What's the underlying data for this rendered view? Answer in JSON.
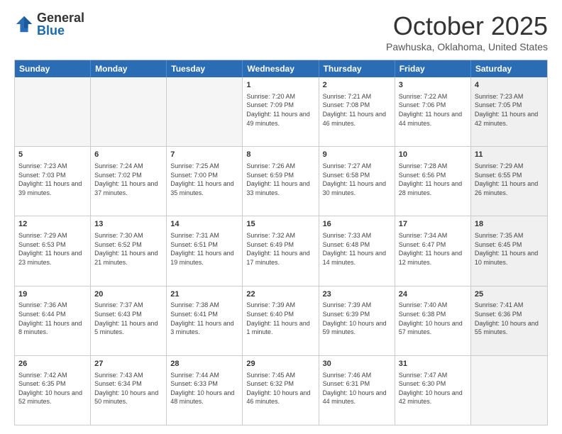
{
  "logo": {
    "general": "General",
    "blue": "Blue"
  },
  "title": "October 2025",
  "location": "Pawhuska, Oklahoma, United States",
  "days": [
    "Sunday",
    "Monday",
    "Tuesday",
    "Wednesday",
    "Thursday",
    "Friday",
    "Saturday"
  ],
  "weeks": [
    [
      {
        "day": "",
        "info": "",
        "empty": true
      },
      {
        "day": "",
        "info": "",
        "empty": true
      },
      {
        "day": "",
        "info": "",
        "empty": true
      },
      {
        "day": "1",
        "info": "Sunrise: 7:20 AM\nSunset: 7:09 PM\nDaylight: 11 hours and 49 minutes."
      },
      {
        "day": "2",
        "info": "Sunrise: 7:21 AM\nSunset: 7:08 PM\nDaylight: 11 hours and 46 minutes."
      },
      {
        "day": "3",
        "info": "Sunrise: 7:22 AM\nSunset: 7:06 PM\nDaylight: 11 hours and 44 minutes."
      },
      {
        "day": "4",
        "info": "Sunrise: 7:23 AM\nSunset: 7:05 PM\nDaylight: 11 hours and 42 minutes."
      }
    ],
    [
      {
        "day": "5",
        "info": "Sunrise: 7:23 AM\nSunset: 7:03 PM\nDaylight: 11 hours and 39 minutes."
      },
      {
        "day": "6",
        "info": "Sunrise: 7:24 AM\nSunset: 7:02 PM\nDaylight: 11 hours and 37 minutes."
      },
      {
        "day": "7",
        "info": "Sunrise: 7:25 AM\nSunset: 7:00 PM\nDaylight: 11 hours and 35 minutes."
      },
      {
        "day": "8",
        "info": "Sunrise: 7:26 AM\nSunset: 6:59 PM\nDaylight: 11 hours and 33 minutes."
      },
      {
        "day": "9",
        "info": "Sunrise: 7:27 AM\nSunset: 6:58 PM\nDaylight: 11 hours and 30 minutes."
      },
      {
        "day": "10",
        "info": "Sunrise: 7:28 AM\nSunset: 6:56 PM\nDaylight: 11 hours and 28 minutes."
      },
      {
        "day": "11",
        "info": "Sunrise: 7:29 AM\nSunset: 6:55 PM\nDaylight: 11 hours and 26 minutes."
      }
    ],
    [
      {
        "day": "12",
        "info": "Sunrise: 7:29 AM\nSunset: 6:53 PM\nDaylight: 11 hours and 23 minutes."
      },
      {
        "day": "13",
        "info": "Sunrise: 7:30 AM\nSunset: 6:52 PM\nDaylight: 11 hours and 21 minutes."
      },
      {
        "day": "14",
        "info": "Sunrise: 7:31 AM\nSunset: 6:51 PM\nDaylight: 11 hours and 19 minutes."
      },
      {
        "day": "15",
        "info": "Sunrise: 7:32 AM\nSunset: 6:49 PM\nDaylight: 11 hours and 17 minutes."
      },
      {
        "day": "16",
        "info": "Sunrise: 7:33 AM\nSunset: 6:48 PM\nDaylight: 11 hours and 14 minutes."
      },
      {
        "day": "17",
        "info": "Sunrise: 7:34 AM\nSunset: 6:47 PM\nDaylight: 11 hours and 12 minutes."
      },
      {
        "day": "18",
        "info": "Sunrise: 7:35 AM\nSunset: 6:45 PM\nDaylight: 11 hours and 10 minutes."
      }
    ],
    [
      {
        "day": "19",
        "info": "Sunrise: 7:36 AM\nSunset: 6:44 PM\nDaylight: 11 hours and 8 minutes."
      },
      {
        "day": "20",
        "info": "Sunrise: 7:37 AM\nSunset: 6:43 PM\nDaylight: 11 hours and 5 minutes."
      },
      {
        "day": "21",
        "info": "Sunrise: 7:38 AM\nSunset: 6:41 PM\nDaylight: 11 hours and 3 minutes."
      },
      {
        "day": "22",
        "info": "Sunrise: 7:39 AM\nSunset: 6:40 PM\nDaylight: 11 hours and 1 minute."
      },
      {
        "day": "23",
        "info": "Sunrise: 7:39 AM\nSunset: 6:39 PM\nDaylight: 10 hours and 59 minutes."
      },
      {
        "day": "24",
        "info": "Sunrise: 7:40 AM\nSunset: 6:38 PM\nDaylight: 10 hours and 57 minutes."
      },
      {
        "day": "25",
        "info": "Sunrise: 7:41 AM\nSunset: 6:36 PM\nDaylight: 10 hours and 55 minutes."
      }
    ],
    [
      {
        "day": "26",
        "info": "Sunrise: 7:42 AM\nSunset: 6:35 PM\nDaylight: 10 hours and 52 minutes."
      },
      {
        "day": "27",
        "info": "Sunrise: 7:43 AM\nSunset: 6:34 PM\nDaylight: 10 hours and 50 minutes."
      },
      {
        "day": "28",
        "info": "Sunrise: 7:44 AM\nSunset: 6:33 PM\nDaylight: 10 hours and 48 minutes."
      },
      {
        "day": "29",
        "info": "Sunrise: 7:45 AM\nSunset: 6:32 PM\nDaylight: 10 hours and 46 minutes."
      },
      {
        "day": "30",
        "info": "Sunrise: 7:46 AM\nSunset: 6:31 PM\nDaylight: 10 hours and 44 minutes."
      },
      {
        "day": "31",
        "info": "Sunrise: 7:47 AM\nSunset: 6:30 PM\nDaylight: 10 hours and 42 minutes."
      },
      {
        "day": "",
        "info": "",
        "empty": true
      }
    ]
  ]
}
